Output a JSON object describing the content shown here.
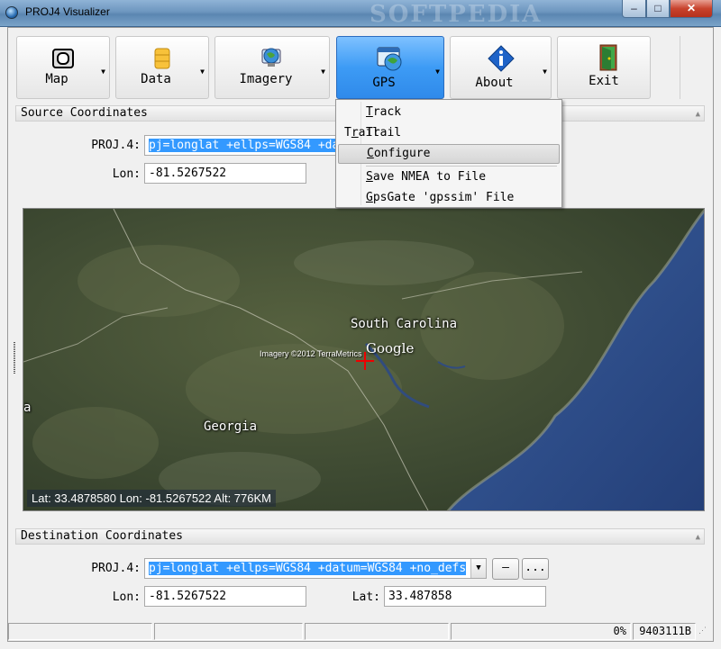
{
  "window": {
    "title": "PROJ4 Visualizer",
    "watermark": "SOFTPEDIA",
    "controls": {
      "minimize": "–",
      "maximize": "□",
      "close": "✕"
    }
  },
  "toolbar": {
    "buttons": [
      {
        "id": "map",
        "label": "Map",
        "icon": "map-frame-icon"
      },
      {
        "id": "data",
        "label": "Data",
        "icon": "database-icon"
      },
      {
        "id": "imagery",
        "label": "Imagery",
        "icon": "globe-monitor-icon"
      },
      {
        "id": "gps",
        "label": "GPS",
        "icon": "gps-globe-icon",
        "active": true
      },
      {
        "id": "about",
        "label": "About",
        "icon": "info-icon"
      },
      {
        "id": "exit",
        "label": "Exit",
        "icon": "exit-door-icon"
      }
    ],
    "dropdown_arrow": "▼"
  },
  "gps_menu": {
    "items": [
      {
        "label": "Track",
        "mnemonic": "T",
        "checked": false
      },
      {
        "label": "Trail",
        "mnemonic": "r",
        "checked": true
      },
      {
        "label": "Configure",
        "mnemonic": "C",
        "checked": false,
        "hover": true
      },
      {
        "label": "Save NMEA to File",
        "mnemonic": "S",
        "checked": false
      },
      {
        "label": "GpsGate 'gpssim' File",
        "mnemonic": "G",
        "checked": false
      }
    ],
    "check_glyph": "✔"
  },
  "source": {
    "section_title": "Source Coordinates",
    "proj_label": "PROJ.4:",
    "proj_value": "pj=longlat +ellps=WGS84 +da",
    "lon_label": "Lon:",
    "lon_value": "-81.5267522"
  },
  "map": {
    "labels": {
      "south_carolina": "South Carolina",
      "georgia": "Georgia",
      "google": "Google",
      "imagery_credit": "Imagery ©2012 TerraMetrics",
      "edge_label": "a"
    },
    "readout": "Lat: 33.4878580  Lon: -81.5267522  Alt: 776KM",
    "colors": {
      "land": "#3f4c35",
      "ocean": "#2c4f8c"
    }
  },
  "destination": {
    "section_title": "Destination Coordinates",
    "proj_label": "PROJ.4:",
    "proj_value": "pj=longlat +ellps=WGS84 +datum=WGS84 +no_defs",
    "lon_label": "Lon:",
    "lon_value": "-81.5267522",
    "lat_label": "Lat:",
    "lat_value": "33.487858",
    "clear_button": "–",
    "more_button": "..."
  },
  "statusbar": {
    "progress": "0%",
    "code": "9403111B"
  }
}
